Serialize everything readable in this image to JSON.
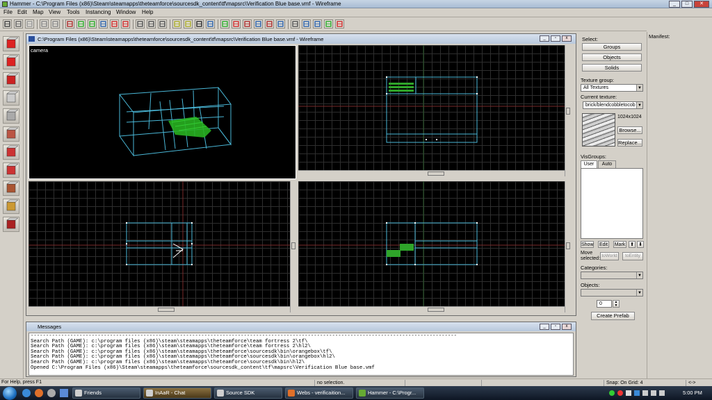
{
  "window": {
    "title": "Hammer - C:\\Program Files (x86)\\Steam\\steamapps\\theteamforce\\sourcesdk_content\\tf\\mapsrc\\Verification Blue base.vmf - Wireframe"
  },
  "menu": [
    "File",
    "Edit",
    "Map",
    "View",
    "Tools",
    "Instancing",
    "Window",
    "Help"
  ],
  "toolbar": {
    "icons": [
      "grid-icon",
      "grid-smaller-icon",
      "grid-larger-icon",
      "undo-icon",
      "redo-icon",
      "carve-icon",
      "group-icon",
      "ungroup-icon",
      "ignore-group-icon",
      "hide-icon",
      "unhide-icon",
      "cut-icon",
      "copy-icon",
      "paste-icon",
      "texture-lock-icon",
      "scale-texture-lock-icon",
      "selection-box-icon",
      "select-icon",
      "toggle-texture-icon",
      "run-map-icon",
      "cordon-icon",
      "entity-report-icon",
      "check-problems-icon",
      "sound-icon",
      "models-icon",
      "cubemaps-icon",
      "cm-icon",
      "leaf-icon",
      "no-draw-icon"
    ]
  },
  "tools": [
    "pointer-tool-icon",
    "magnify-tool-icon",
    "camera-tool-icon",
    "entity-tool-icon",
    "block-tool-icon",
    "texture-app-icon",
    "apply-texture-icon",
    "decal-tool-icon",
    "overlay-tool-icon",
    "clip-tool-icon",
    "vertex-tool-icon"
  ],
  "mapwindow": {
    "title": "C:\\Program Files (x86)\\Steam\\steamapps\\theteamforce\\sourcesdk_content\\tf\\mapsrc\\Verification Blue base.vmf - Wireframe",
    "camera_label": "camera"
  },
  "select_panel": {
    "label": "Select:",
    "groups": "Groups",
    "objects": "Objects",
    "solids": "Solids"
  },
  "texture_panel": {
    "group_label": "Texture group:",
    "group_value": "All Textures",
    "current_label": "Current texture:",
    "current_value": "brick/blendcobbletocob",
    "size": "1024x1024",
    "browse": "Browse...",
    "replace": "Replace..."
  },
  "visgroups": {
    "label": "VisGroups:",
    "tabs": [
      "User",
      "Auto"
    ],
    "show": "Show",
    "edit": "Edit",
    "mark": "Mark",
    "up": "⬆",
    "down": "⬇",
    "move_label": "Move selected:",
    "to_world": "toWorld",
    "to_entity": "toEntity"
  },
  "prefab": {
    "categories_label": "Categories:",
    "objects_label": "Objects:",
    "count": "0",
    "create": "Create Prefab"
  },
  "manifest": {
    "label": "Manifest:"
  },
  "messages": {
    "title": "Messages",
    "lines": [
      "--------------------------------------------------------------------------------------------------------------------------------------------",
      "Search Path (GAME): c:\\program files (x86)\\steam\\steamapps\\theteamforce\\team fortress 2\\tf\\",
      "Search Path (GAME): c:\\program files (x86)\\steam\\steamapps\\theteamforce\\team fortress 2\\hl2\\",
      "Search Path (GAME): c:\\program files (x86)\\steam\\steamapps\\theteamforce\\sourcesdk\\bin\\orangebox\\tf\\",
      "Search Path (GAME): c:\\program files (x86)\\steam\\steamapps\\theteamforce\\sourcesdk\\bin\\orangebox\\hl2\\",
      "Search Path (GAME): c:\\program files (x86)\\steam\\steamapps\\theteamforce\\sourcesdk\\bin\\hl2\\",
      "Opened C:\\Program Files (x86)\\Steam\\steamapps\\theteamforce\\sourcesdk_content\\tf\\mapsrc\\Verification Blue base.vmf"
    ]
  },
  "status": {
    "help": "For Help, press F1",
    "selection": "no selection.",
    "grid": "Snap: On Grid: 4",
    "arrows": "<->"
  },
  "taskbar": {
    "tasks": [
      "Friends",
      "InAaR - Chat",
      "Source SDK",
      "Webs - verificaition...",
      "Hammer - C:\\Progr..."
    ],
    "clock": "5:00 PM"
  },
  "colors": {
    "accent": "#2a4f9c",
    "wire": "#4ab8d8",
    "green": "#2fa52a"
  }
}
